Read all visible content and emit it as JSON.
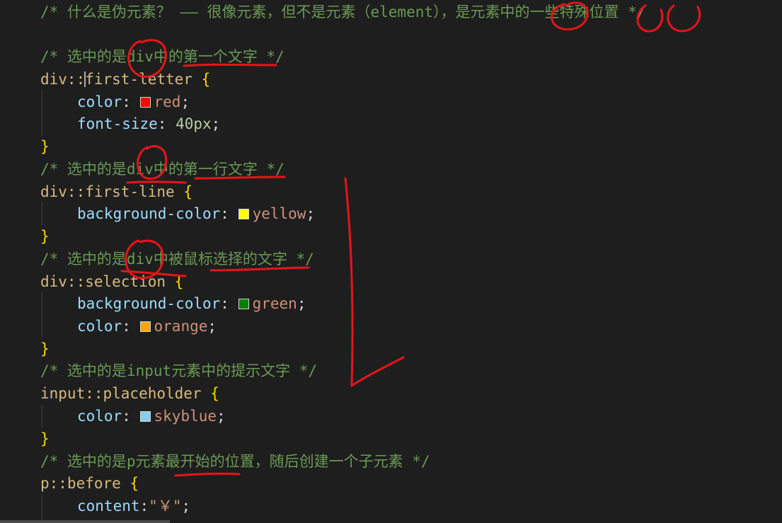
{
  "colors": {
    "background": "#1e1e1e",
    "comment": "#6a9955",
    "selector": "#d7ba7d",
    "property": "#9cdcfe",
    "value": "#ce9178",
    "brace": "#ffd700",
    "annotation_ink": "#e8141a"
  },
  "editor": {
    "comment_intro": "/* 什么是伪元素？ —— 很像元素，但不是元素（element），是元素中的一些特殊位置 */",
    "blocks": [
      {
        "comment": "/* 选中的是div中的第一个文字 */",
        "selector": "div::first-letter",
        "declarations": [
          {
            "property": "color",
            "value": "red",
            "swatch": "#ff0000"
          },
          {
            "property": "font-size",
            "value": "40px"
          }
        ]
      },
      {
        "comment": "/* 选中的是div中的第一行文字 */",
        "selector": "div::first-line",
        "declarations": [
          {
            "property": "background-color",
            "value": "yellow",
            "swatch": "#ffff00"
          }
        ]
      },
      {
        "comment": "/* 选中的是div中被鼠标选择的文字 */",
        "selector": "div::selection",
        "declarations": [
          {
            "property": "background-color",
            "value": "green",
            "swatch": "#008000"
          },
          {
            "property": "color",
            "value": "orange",
            "swatch": "#ffa500"
          }
        ]
      },
      {
        "comment": "/* 选中的是input元素中的提示文字 */",
        "selector": "input::placeholder",
        "declarations": [
          {
            "property": "color",
            "value": "skyblue",
            "swatch": "#87ceeb"
          }
        ]
      },
      {
        "comment": "/* 选中的是p元素最开始的位置，随后创建一个子元素 */",
        "selector": "p::before",
        "declarations": [
          {
            "property": "content",
            "value": "\"￥\""
          }
        ]
      }
    ],
    "open_brace": "{",
    "close_brace": "}"
  }
}
